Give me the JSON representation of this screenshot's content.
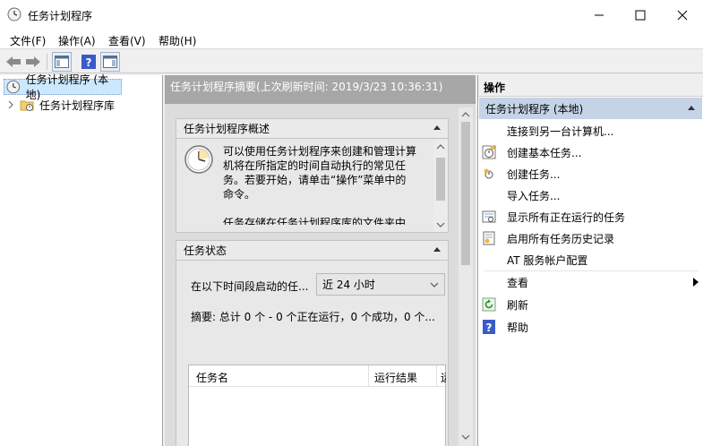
{
  "window": {
    "title": "任务计划程序",
    "icons": {
      "app": "clock-icon",
      "minimize": "minimize-icon",
      "maximize": "maximize-icon",
      "close": "close-icon"
    }
  },
  "menu": {
    "file": "文件(F)",
    "action": "操作(A)",
    "view": "查看(V)",
    "help": "帮助(H)"
  },
  "tree": {
    "root": "任务计划程序 (本地)",
    "library": "任务计划程序库"
  },
  "center": {
    "header": "任务计划程序摘要(上次刷新时间: 2019/3/23 10:36:31)",
    "overview": {
      "title": "任务计划程序概述",
      "text1": "可以使用任务计划程序来创建和管理计算",
      "text2": "机将在所指定的时间自动执行的常见任",
      "text3": "务。若要开始，请单击“操作”菜单中的",
      "text4": "命令。",
      "text5": "任务存储在任务计划程序库的文件夹中"
    },
    "status": {
      "title": "任务状态",
      "period_label": "在以下时间段启动的任...",
      "period_value": "近 24 小时",
      "summary": "摘要: 总计 0 个 - 0 个正在运行，0 个成功，0 个...",
      "col_name": "任务名",
      "col_result": "运行结果",
      "col_more": "运"
    }
  },
  "actions": {
    "header": "操作",
    "group": "任务计划程序 (本地)",
    "items": [
      "连接到另一台计算机...",
      "创建基本任务...",
      "创建任务...",
      "导入任务...",
      "显示所有正在运行的任务",
      "启用所有任务历史记录",
      "AT 服务帐户配置",
      "查看",
      "刷新",
      "帮助"
    ]
  },
  "colors": {
    "accent_header": "#a7a7a7",
    "group_header": "#c4d3e6",
    "selection": "#cce8ff",
    "help_blue": "#3a5bc7"
  }
}
